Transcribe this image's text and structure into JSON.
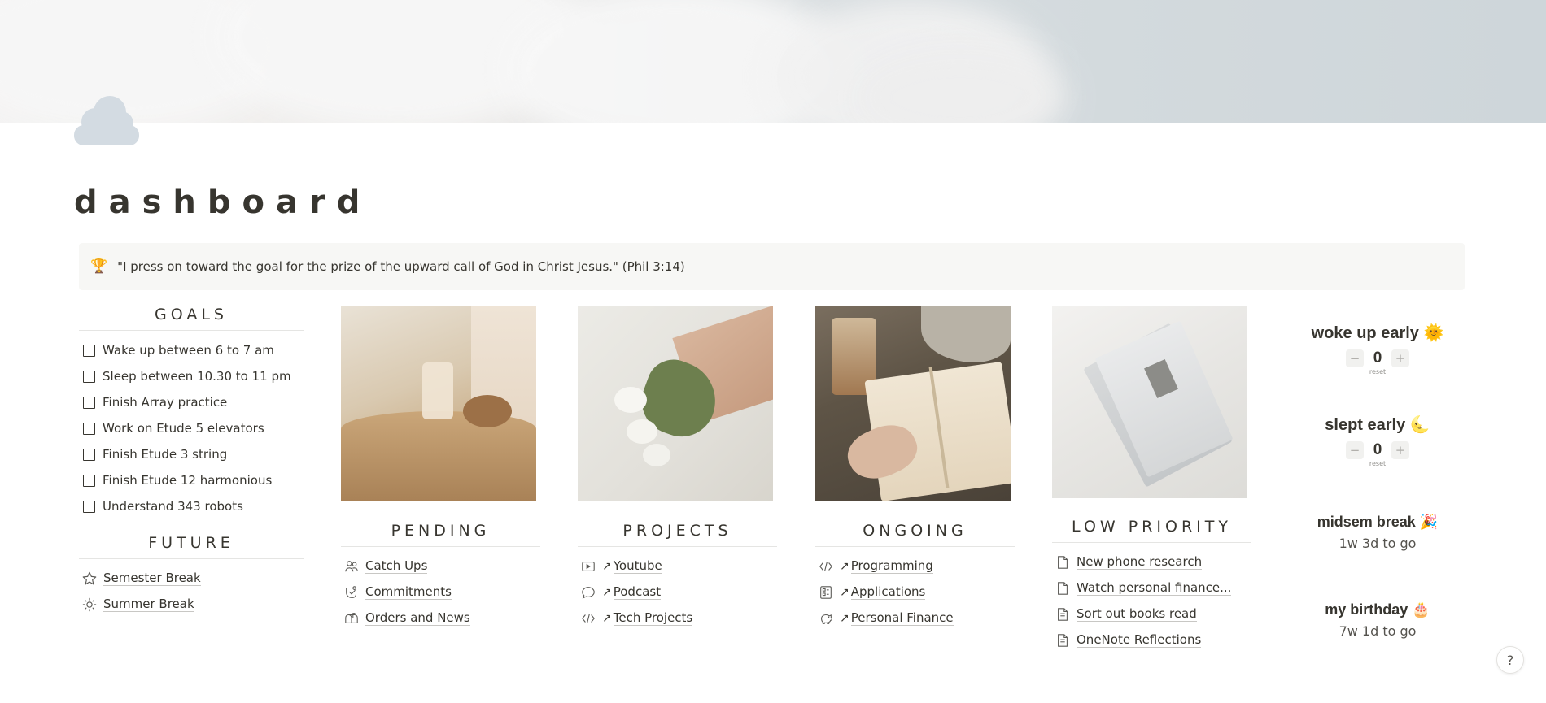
{
  "page": {
    "title": "dashboard",
    "quote_emoji": "🏆",
    "quote": "\"I press on toward the goal for the prize of the upward call of God in Christ Jesus.\" (Phil 3:14)"
  },
  "goals": {
    "heading": "GOALS",
    "items": [
      "Wake up between 6 to 7 am",
      "Sleep between 10.30 to 11 pm",
      "Finish Array practice",
      "Work on Etude 5 elevators",
      "Finish Etude 3 string",
      "Finish Etude 12 harmonious",
      "Understand 343 robots"
    ]
  },
  "future": {
    "heading": "FUTURE",
    "items": [
      {
        "label": "Semester Break",
        "icon": "star-icon"
      },
      {
        "label": "Summer Break",
        "icon": "sun-icon"
      }
    ]
  },
  "pending": {
    "heading": "PENDING",
    "items": [
      {
        "label": "Catch Ups",
        "icon": "people-icon"
      },
      {
        "label": "Commitments",
        "icon": "handshake-icon"
      },
      {
        "label": "Orders and News",
        "icon": "mailbox-icon"
      }
    ]
  },
  "projects": {
    "heading": "PROJECTS",
    "items": [
      {
        "label": "Youtube",
        "icon": "video-icon"
      },
      {
        "label": "Podcast",
        "icon": "chat-bubble-icon"
      },
      {
        "label": "Tech Projects",
        "icon": "code-icon"
      }
    ]
  },
  "ongoing": {
    "heading": "ONGOING",
    "items": [
      {
        "label": "Programming",
        "icon": "code-icon"
      },
      {
        "label": "Applications",
        "icon": "form-icon"
      },
      {
        "label": "Personal Finance",
        "icon": "piggy-bank-icon"
      }
    ]
  },
  "low_priority": {
    "heading": "LOW PRIORITY",
    "items": [
      {
        "label": "New phone research",
        "icon": "page-icon"
      },
      {
        "label": "Watch personal finance...",
        "icon": "page-icon"
      },
      {
        "label": "Sort out books read",
        "icon": "document-icon"
      },
      {
        "label": "OneNote Reflections",
        "icon": "document-icon"
      }
    ]
  },
  "counters": [
    {
      "name": "woke up early",
      "emoji": "🌞",
      "value": "0",
      "minus": "−",
      "plus": "+",
      "reset": "reset"
    },
    {
      "name": "slept early",
      "emoji": "🌜",
      "value": "0",
      "minus": "−",
      "plus": "+",
      "reset": "reset"
    }
  ],
  "countdowns": [
    {
      "name": "midsem break",
      "emoji": "🎉",
      "remaining": "1w 3d to go"
    },
    {
      "name": "my birthday",
      "emoji": "🎂",
      "remaining": "7w 1d to go"
    }
  ],
  "help": "?"
}
